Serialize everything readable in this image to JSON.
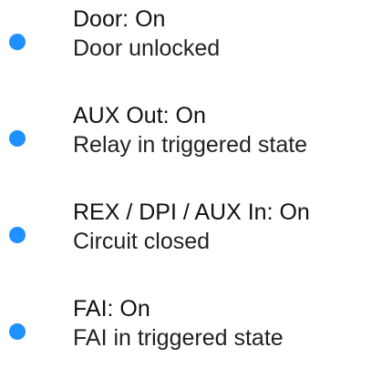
{
  "colors": {
    "indicator": "#1e90ff"
  },
  "status_list": [
    {
      "title": "Door: On",
      "description": "Door unlocked",
      "indicator_icon": "status-dot-icon"
    },
    {
      "title": "AUX Out: On",
      "description": "Relay in triggered state",
      "indicator_icon": "status-dot-icon"
    },
    {
      "title": "REX / DPI / AUX In: On",
      "description": "Circuit closed",
      "indicator_icon": "status-dot-icon"
    },
    {
      "title": "FAI: On",
      "description": "FAI in triggered state",
      "indicator_icon": "status-dot-icon"
    }
  ]
}
